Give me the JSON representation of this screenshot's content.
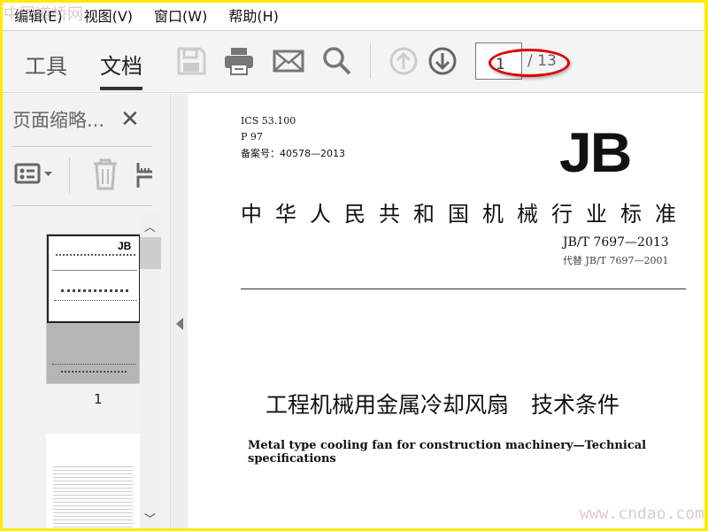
{
  "menu": [
    "编辑(E)",
    "视图(V)",
    "窗口(W)",
    "帮助(H)"
  ],
  "toolbar": {
    "tab_tools": "工具",
    "tab_document": "文档",
    "current_page": "1",
    "total_pages": "/ 13"
  },
  "sidebar": {
    "title": "页面缩略...",
    "thumbnail_label": "1"
  },
  "document": {
    "ics": "ICS 53.100",
    "p": "P 97",
    "record": "备案号：40578—2013",
    "logo": "JB",
    "national": "中华人民共和国机械行业标准",
    "standard": "JB/T 7697—2013",
    "replaces": "代替 JB/T 7697—2001",
    "title_cn": "工程机械用金属冷却风扇　技术条件",
    "title_en": "Metal type cooling fan for construction machinery—Technical specifications"
  },
  "watermarks": {
    "top": "中国道桥网",
    "bottom": "www.cndao.com"
  },
  "colors": {
    "highlight": "#dd0000",
    "frame": "#ffea00"
  }
}
